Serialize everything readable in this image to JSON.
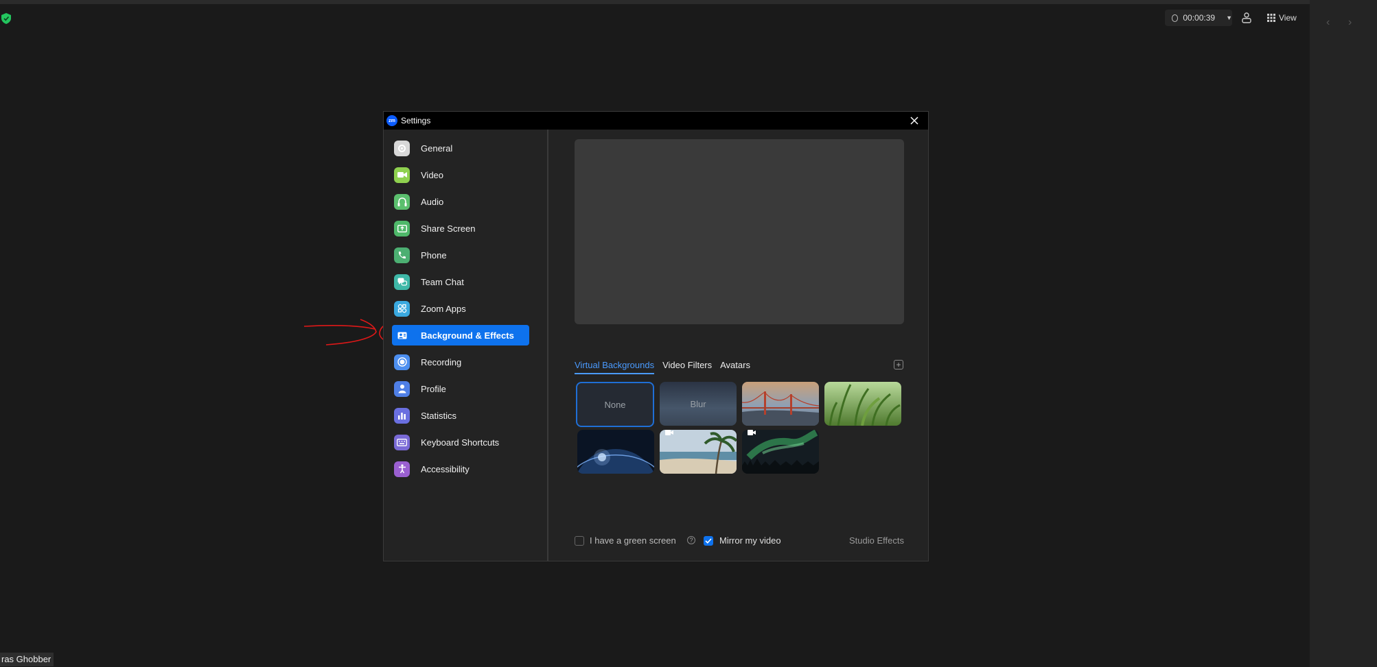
{
  "top_bar": {
    "timer": "00:00:39",
    "view_label": "View"
  },
  "participant_name": "ras Ghobber",
  "dialog": {
    "title": "Settings",
    "menu": [
      {
        "label": "General",
        "icon": "gear-icon",
        "color": "#d8d8d8"
      },
      {
        "label": "Video",
        "icon": "video-camera-icon",
        "color": "#8fd14f"
      },
      {
        "label": "Audio",
        "icon": "headphones-icon",
        "color": "#5bbf6e"
      },
      {
        "label": "Share Screen",
        "icon": "share-screen-icon",
        "color": "#4fb86a"
      },
      {
        "label": "Phone",
        "icon": "phone-icon",
        "color": "#4caf72"
      },
      {
        "label": "Team Chat",
        "icon": "chat-icon",
        "color": "#3fb8a8"
      },
      {
        "label": "Zoom Apps",
        "icon": "apps-icon",
        "color": "#3aa9e0"
      },
      {
        "label": "Background & Effects",
        "icon": "background-icon",
        "color": "#0e72ed",
        "active": true
      },
      {
        "label": "Recording",
        "icon": "record-icon",
        "color": "#4d8ff0"
      },
      {
        "label": "Profile",
        "icon": "profile-icon",
        "color": "#4f7fe6"
      },
      {
        "label": "Statistics",
        "icon": "statistics-icon",
        "color": "#6a6fe0"
      },
      {
        "label": "Keyboard Shortcuts",
        "icon": "keyboard-icon",
        "color": "#7a6ad6"
      },
      {
        "label": "Accessibility",
        "icon": "accessibility-icon",
        "color": "#9a5fd0"
      }
    ],
    "tabs": [
      "Virtual Backgrounds",
      "Video Filters",
      "Avatars"
    ],
    "tiles": {
      "none_label": "None",
      "blur_label": "Blur"
    },
    "green_screen_label": "I have a green screen",
    "mirror_label": "Mirror my video",
    "studio_effects_label": "Studio Effects",
    "accent_color": "#0e72ed"
  }
}
